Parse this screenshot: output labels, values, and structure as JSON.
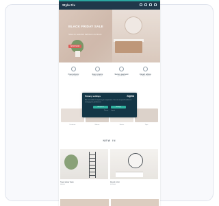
{
  "header": {
    "logo": "Style Fix",
    "icons": [
      "search-icon",
      "account-icon",
      "heart-icon",
      "cart-icon"
    ]
  },
  "hero": {
    "title": "BLACK FRIDAY SALE",
    "subtitle": "Save on selected bathroom furniture",
    "button": "SHOP NOW"
  },
  "usps": [
    {
      "icon": "truck-icon",
      "title": "Free delivery",
      "text": "on all orders"
    },
    {
      "icon": "return-icon",
      "title": "Easy returns",
      "text": "within 30 days"
    },
    {
      "icon": "shield-icon",
      "title": "Secure payment",
      "text": "guaranteed"
    },
    {
      "icon": "tool-icon",
      "title": "Expert advice",
      "text": "7 days a week"
    }
  ],
  "categories": [
    "Furniture",
    "Mirrors",
    "Basins",
    "Taps"
  ],
  "section": {
    "title": "NEW IN"
  },
  "products": [
    {
      "name": "Towel ladder black",
      "price": "£89.00"
    },
    {
      "name": "Round mirror",
      "price": "£129.00"
    }
  ],
  "cookie_dialog": {
    "title": "Privacy settings",
    "brand": "Sigma",
    "body": "We use cookies to improve your experience. You can accept all cookies or manage your preferences.",
    "accept_label": "Accept all",
    "settings_label": "Settings",
    "links": [
      "Privacy",
      "Imprint"
    ]
  },
  "colors": {
    "header_bg": "#20384a",
    "accent_teal": "#2aa6a0",
    "hero_button": "#d9514b",
    "dialog_bg": "#143646"
  }
}
